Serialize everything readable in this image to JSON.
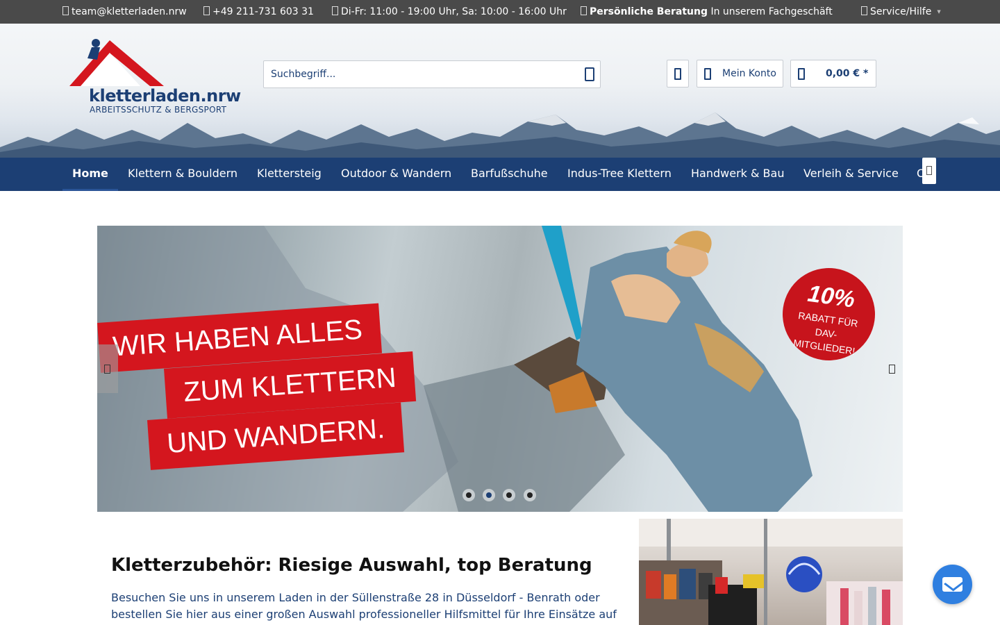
{
  "topbar": {
    "email": "team@kletterladen.nrw",
    "phone": "+49 211-731 603 31",
    "hours": "Di-Fr: 11:00 - 19:00 Uhr, Sa: 10:00 - 16:00 Uhr",
    "advice_bold": "Persönliche Beratung",
    "advice_rest": "In unserem Fachgeschäft",
    "service": "Service/Hilfe"
  },
  "logo": {
    "name": "kletterladen.nrw",
    "tagline": "ARBEITSSCHUTZ & BERGSPORT"
  },
  "search": {
    "placeholder": "Suchbegriff..."
  },
  "header_actions": {
    "account_label": "Mein Konto",
    "cart_total": "0,00 € *"
  },
  "nav": {
    "items": [
      "Home",
      "Klettern & Bouldern",
      "Klettersteig",
      "Outdoor & Wandern",
      "Barfußschuhe",
      "Indus-Tree Klettern",
      "Handwerk & Bau",
      "Verleih & Service"
    ],
    "overflow_text": "O"
  },
  "slider": {
    "lines": [
      "WIR HABEN ALLES",
      "ZUM KLETTERN",
      "UND WANDERN."
    ],
    "badge_big": "10%",
    "badge_small": "RABATT FÜR DAV-MITGLIEDER!",
    "active_slide": 2,
    "slide_count": 4
  },
  "content": {
    "title": "Kletterzubehör: Riesige Auswahl, top Beratung",
    "text": "Besuchen Sie uns in unserem Laden in der Süllenstraße 28 in Düsseldorf - Benrath oder bestellen Sie hier aus einer großen Auswahl professioneller Hilfsmittel für Ihre Einsätze auf"
  },
  "colors": {
    "topbar": "#4a4a4a",
    "brand_blue": "#1c3f74",
    "banner_red": "#d4161e",
    "fab_blue": "#2f7fe0"
  },
  "icons": {
    "email": "envelope-icon",
    "phone": "phone-icon",
    "hours": "clock-icon",
    "advice": "chat-icon",
    "service": "info-icon",
    "search": "search-icon",
    "wishlist": "heart-icon",
    "account": "user-icon",
    "cart": "bag-icon",
    "contact": "envelope-icon"
  }
}
